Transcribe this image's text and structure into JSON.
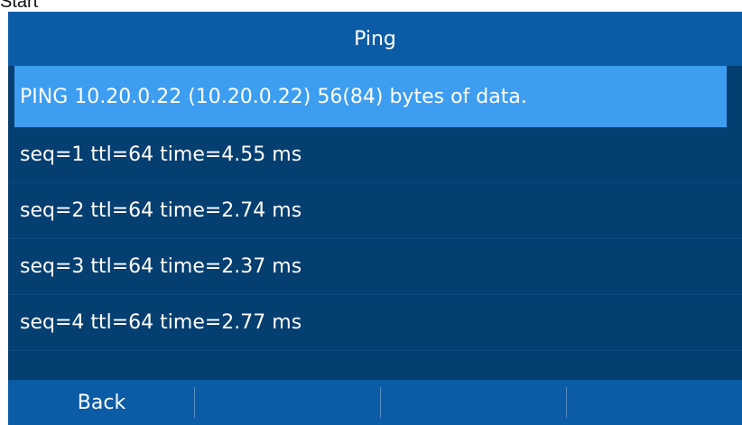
{
  "top_label": "Start",
  "screen": {
    "title": "Ping",
    "rows": [
      "PING 10.20.0.22 (10.20.0.22) 56(84) bytes of data.",
      "seq=1 ttl=64 time=4.55 ms",
      "seq=2 ttl=64 time=2.74 ms",
      "seq=3 ttl=64 time=2.37 ms",
      "seq=4 ttl=64 time=2.77 ms"
    ],
    "selected_row_index": 0,
    "softkeys": [
      "Back",
      "",
      "",
      ""
    ]
  },
  "colors": {
    "background": "#053f71",
    "title_bar": "#0c5ba6",
    "selected_row": "#3d9df0",
    "text": "#ffffff"
  }
}
